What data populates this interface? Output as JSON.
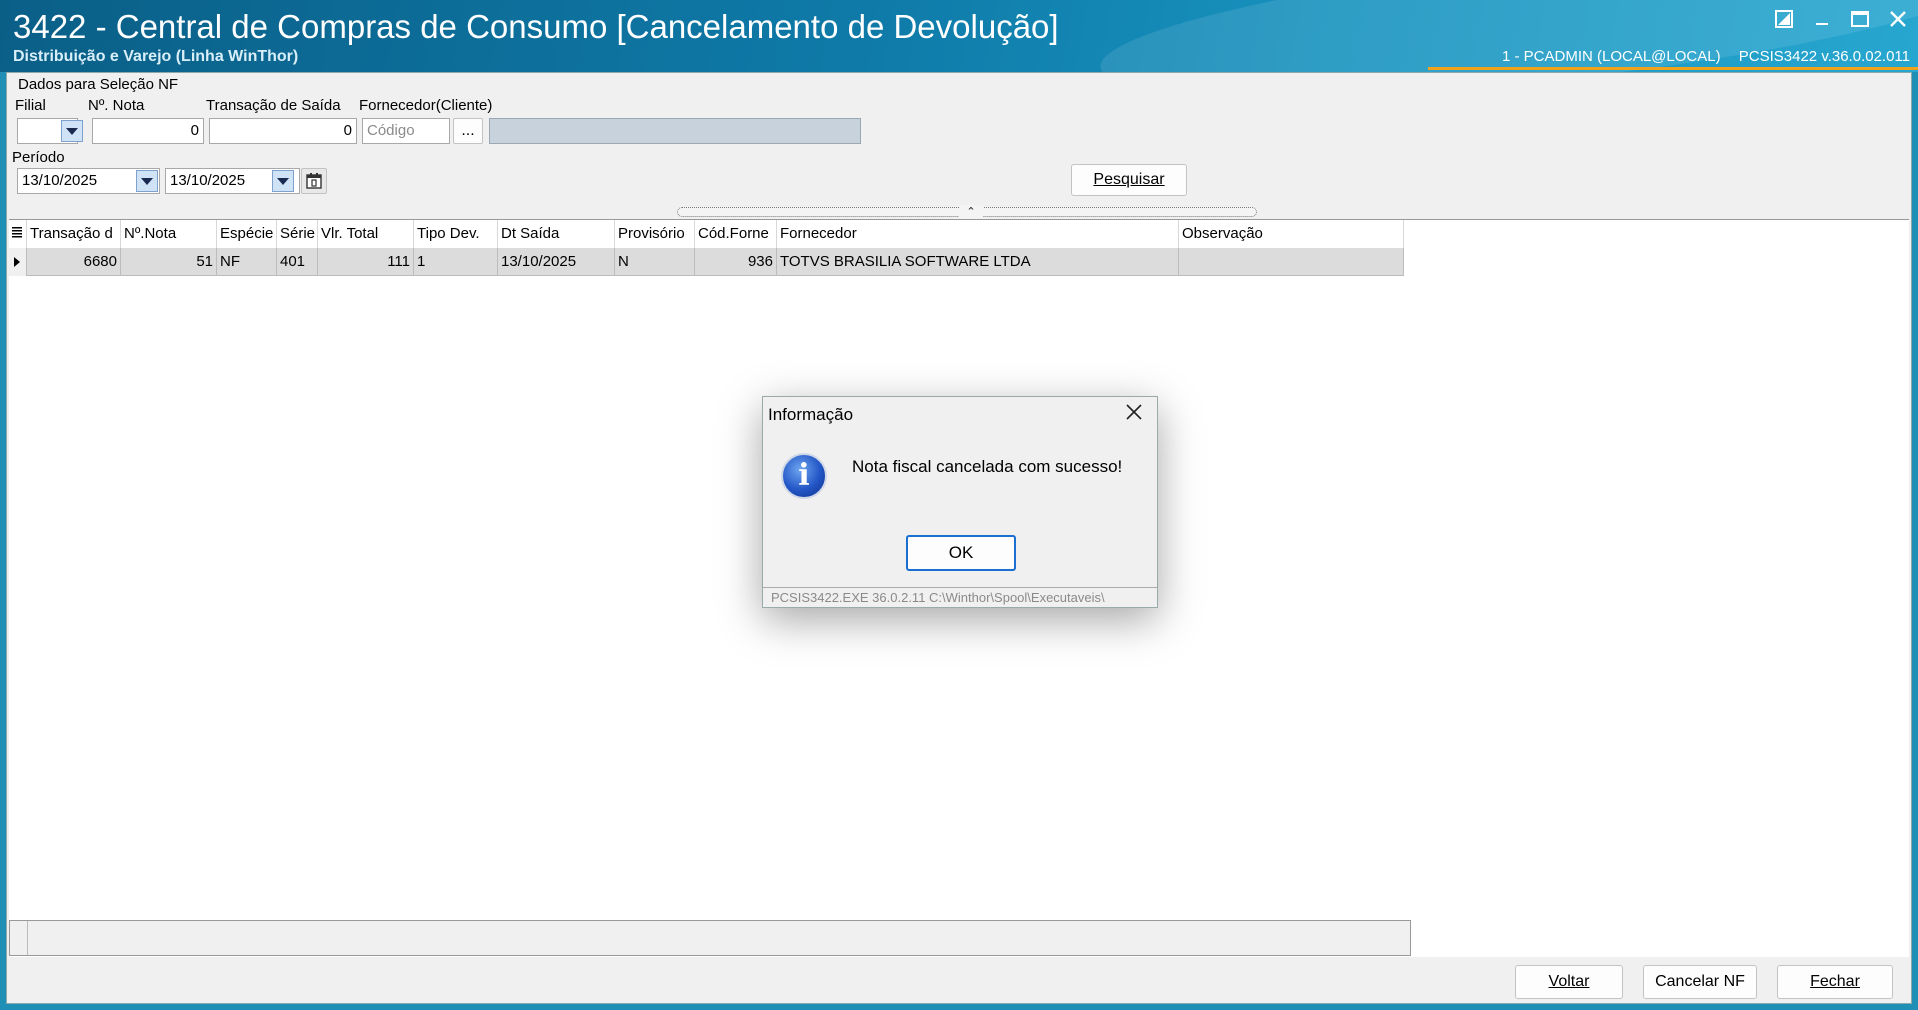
{
  "window": {
    "title": "3422 - Central de Compras de Consumo [Cancelamento de Devolução]",
    "subtitle": "Distribuição e Varejo (Linha WinThor)",
    "user": "1 - PCADMIN (LOCAL@LOCAL)",
    "version": "PCSIS3422  v.36.0.02.011"
  },
  "filters": {
    "section_title": "Dados para Seleção NF",
    "filial_label": "Filial",
    "nota_label": "Nº. Nota",
    "nota_value": "0",
    "transacao_label": "Transação de Saída",
    "transacao_value": "0",
    "fornecedor_label": "Fornecedor(Cliente)",
    "fornecedor_placeholder": "Código",
    "ellipsis": "...",
    "periodo_label": "Período",
    "date_from": "13/10/2025",
    "date_to": "13/10/2025",
    "pesquisar": "Pesquisar"
  },
  "grid": {
    "columns": [
      "Transação d",
      "Nº.Nota",
      "Espécie",
      "Série",
      "Vlr. Total",
      "Tipo Dev.",
      "Dt Saída",
      "Provisório",
      "Cód.Forne",
      "Fornecedor",
      "Observação"
    ],
    "rows": [
      {
        "transacao": "6680",
        "nota": "51",
        "especie": "NF",
        "serie": "401",
        "vlr_total": "111",
        "tipo_dev": "1",
        "dt_saida": "13/10/2025",
        "provisorio": "N",
        "cod_forne": "936",
        "fornecedor": "TOTVS BRASILIA SOFTWARE LTDA",
        "observacao": ""
      }
    ]
  },
  "dialog": {
    "title": "Informação",
    "message": "Nota fiscal cancelada com sucesso!",
    "ok": "OK",
    "status": "PCSIS3422.EXE 36.0.2.11 C:\\Winthor\\Spool\\Executaveis\\"
  },
  "buttons": {
    "voltar": "Voltar",
    "cancelar": "Cancelar NF",
    "fechar": "Fechar"
  }
}
